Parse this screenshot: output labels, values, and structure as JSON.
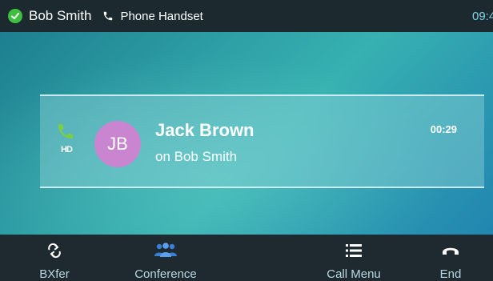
{
  "status_bar": {
    "user_name": "Bob Smith",
    "line_label": "Phone Handset",
    "time": "09:4",
    "status_color": "#3fbf3f"
  },
  "call": {
    "avatar_initials": "JB",
    "avatar_color": "#c985cf",
    "caller_name": "Jack Brown",
    "line_info": "on Bob Smith",
    "timer": "00:29",
    "hd_label": "HD",
    "call_icon_color": "#7cd13a"
  },
  "softkeys": [
    {
      "label": "BXfer",
      "icon": "transfer-icon"
    },
    {
      "label": "Conference",
      "icon": "conference-icon"
    },
    {
      "label": "Call Menu",
      "icon": "menu-icon"
    },
    {
      "label": "End",
      "icon": "hangup-icon"
    }
  ]
}
